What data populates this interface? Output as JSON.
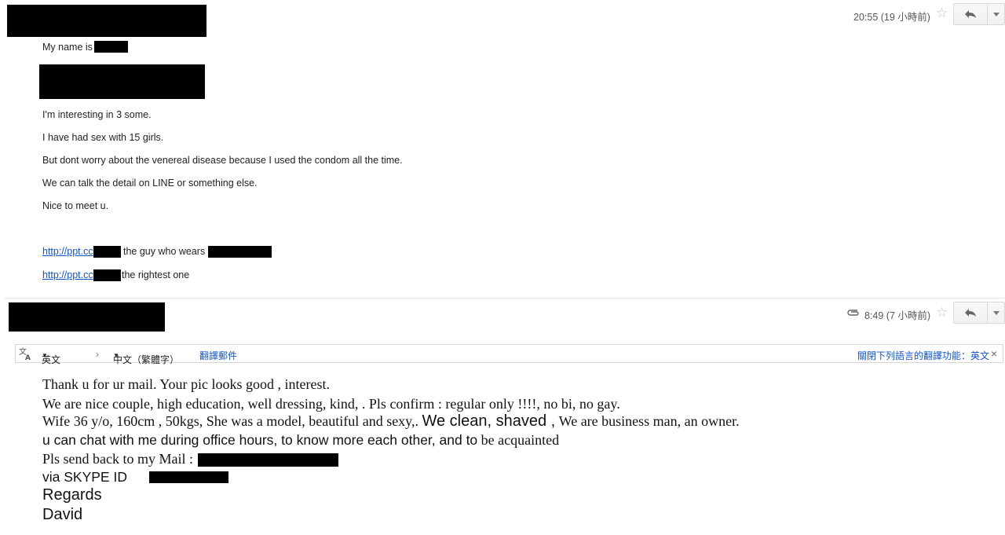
{
  "message1": {
    "time": "20:55 (19 小時前)",
    "star_icon": "star-outline-icon",
    "lines": {
      "name": "My name is",
      "l1": "I'm interesting in 3 some.",
      "l2": "I have had sex with 15 girls.",
      "l3": "But dont worry about the venereal disease because I used the condom all the time.",
      "l4": "We can talk the detail on LINE or something else.",
      "l5": "Nice to meet u.",
      "link1": "http://ppt.cc",
      "link1_suffix": "the guy who wears",
      "link2": "http://ppt.cc",
      "link2_suffix": "the rightest one"
    }
  },
  "message2": {
    "time": "8:49 (7 小時前)",
    "attachment_icon": "paperclip-icon",
    "translate_bar": {
      "icon": "translate-icon",
      "source_lang": "英文",
      "arrow": "›",
      "target_lang": "中文（繁體字）",
      "translate_link": "翻譯郵件",
      "turn_off": "關閉下列語言的翻譯功能：英文",
      "close": "×"
    },
    "body": {
      "l1": "Thank u for ur mail. Your pic looks good , interest.",
      "l2": "We are nice couple, high education, well dressing, kind, . Pls confirm : regular only !!!!, no bi, no gay.",
      "l3a": "Wife 36 y/o, 160cm , 50kgs, She was a model, beautiful and sexy,.",
      "l3b": "We clean, shaved ,",
      "l3c": "We are business man, an owner.",
      "l4a": "u can chat with me  during office hours, to know more each other, and to",
      "l4b": "be acquainted",
      "l5": "Pls send back to my Mail :",
      "l6": "via SKYPE  ID",
      "l7": "Regards",
      "l8": "David"
    }
  },
  "colors": {
    "link": "#1155cc",
    "redaction": "#000000"
  }
}
